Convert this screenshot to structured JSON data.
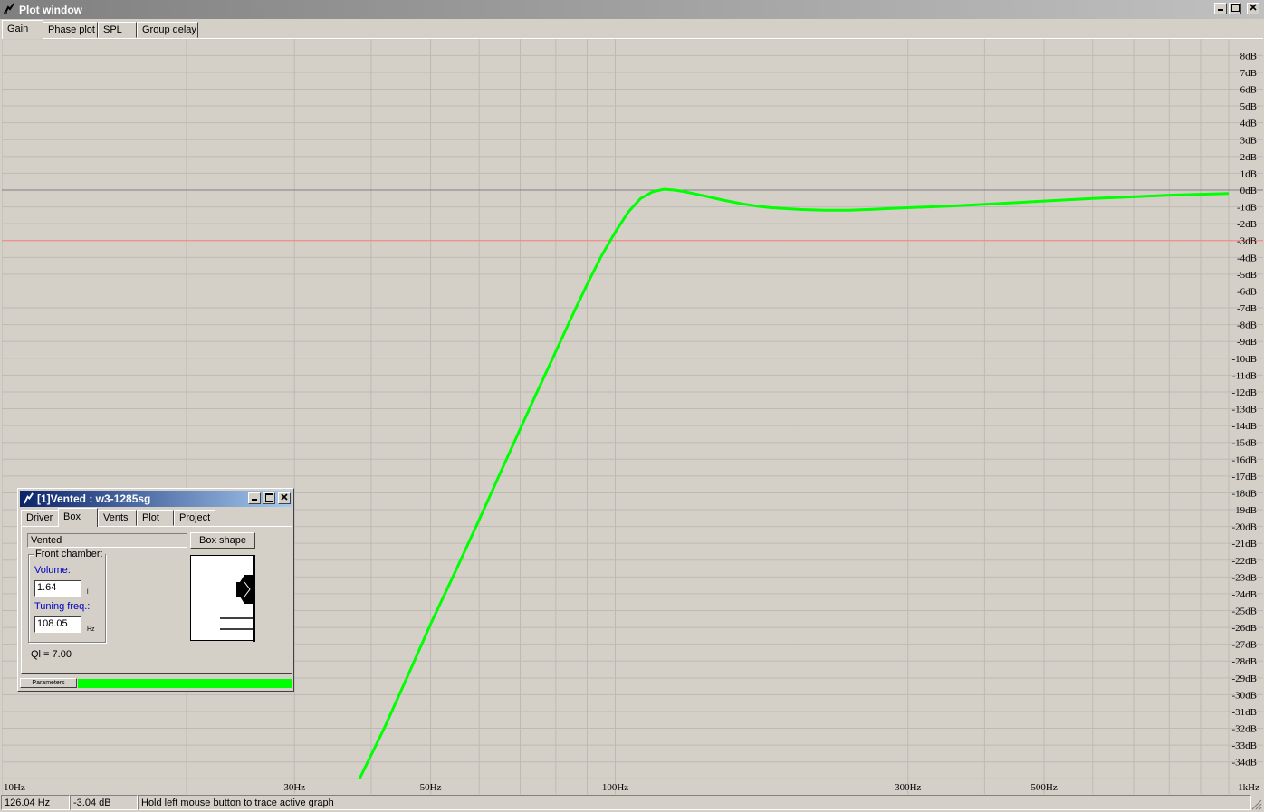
{
  "window": {
    "title": "Plot window",
    "tabs": [
      {
        "label": "Gain",
        "active": true
      },
      {
        "label": "Phase plot",
        "active": false
      },
      {
        "label": "SPL",
        "active": false
      },
      {
        "label": "Group delay",
        "active": false
      }
    ]
  },
  "chart_data": {
    "type": "line",
    "x_scale": "log",
    "xlim": [
      10,
      1000
    ],
    "ylim": [
      -35,
      9
    ],
    "x_tick_labels": [
      {
        "x": 10,
        "label": "10Hz"
      },
      {
        "x": 30,
        "label": "30Hz"
      },
      {
        "x": 50,
        "label": "50Hz"
      },
      {
        "x": 100,
        "label": "100Hz"
      },
      {
        "x": 300,
        "label": "300Hz"
      },
      {
        "x": 500,
        "label": "500Hz"
      },
      {
        "x": 1000,
        "label": "1kHz"
      }
    ],
    "y_tick_labels": [
      "8dB",
      "7dB",
      "6dB",
      "5dB",
      "4dB",
      "3dB",
      "2dB",
      "1dB",
      "0dB",
      "-1dB",
      "-2dB",
      "-3dB",
      "-4dB",
      "-5dB",
      "-6dB",
      "-7dB",
      "-8dB",
      "-9dB",
      "-10dB",
      "-11dB",
      "-12dB",
      "-13dB",
      "-14dB",
      "-15dB",
      "-16dB",
      "-17dB",
      "-18dB",
      "-19dB",
      "-20dB",
      "-21dB",
      "-22dB",
      "-23dB",
      "-24dB",
      "-25dB",
      "-26dB",
      "-27dB",
      "-28dB",
      "-29dB",
      "-30dB",
      "-31dB",
      "-32dB",
      "-33dB",
      "-34dB"
    ],
    "reference_lines": [
      {
        "y": 0,
        "color": "#808080"
      },
      {
        "y": -3,
        "color": "#ff8080"
      }
    ],
    "grid": true,
    "series": [
      {
        "color": "#00ff00",
        "x": [
          38.3,
          42,
          46,
          50,
          55,
          60,
          65,
          70,
          75,
          80,
          85,
          90,
          95,
          100,
          105,
          110,
          115,
          120,
          125,
          130,
          140,
          150,
          160,
          170,
          180,
          200,
          220,
          240,
          260,
          280,
          300,
          350,
          400,
          450,
          500,
          600,
          700,
          800,
          900,
          1000
        ],
        "y": [
          -35.0,
          -32.0,
          -28.8,
          -25.8,
          -22.6,
          -19.6,
          -16.8,
          -14.2,
          -11.8,
          -9.6,
          -7.5,
          -5.6,
          -3.9,
          -2.5,
          -1.3,
          -0.5,
          -0.1,
          0.05,
          0.0,
          -0.1,
          -0.35,
          -0.6,
          -0.8,
          -0.95,
          -1.05,
          -1.15,
          -1.2,
          -1.2,
          -1.15,
          -1.1,
          -1.05,
          -0.95,
          -0.85,
          -0.75,
          -0.65,
          -0.5,
          -0.4,
          -0.3,
          -0.25,
          -0.2
        ]
      }
    ]
  },
  "status": {
    "frequency": "126.04 Hz",
    "gain": "-3.04 dB",
    "hint": "Hold left mouse button to trace active graph"
  },
  "child_window": {
    "title": "[1]Vented : w3-1285sg",
    "tabs": [
      {
        "label": "Driver",
        "active": false
      },
      {
        "label": "Box",
        "active": true
      },
      {
        "label": "Vents",
        "active": false
      },
      {
        "label": "Plot",
        "active": false
      },
      {
        "label": "Project",
        "active": false
      }
    ],
    "box_type": "Vented",
    "box_shape_button": "Box shape",
    "front_chamber_label": "Front chamber:",
    "volume_label": "Volume:",
    "volume_value": "1.64",
    "volume_unit": "l",
    "tuning_label": "Tuning freq.:",
    "tuning_value": "108.05",
    "tuning_unit": "Hz",
    "ql_text": "Ql = 7.00",
    "progress_label": "Parameters",
    "progress_fraction": 1.0,
    "progress_color": "#00ff00"
  }
}
